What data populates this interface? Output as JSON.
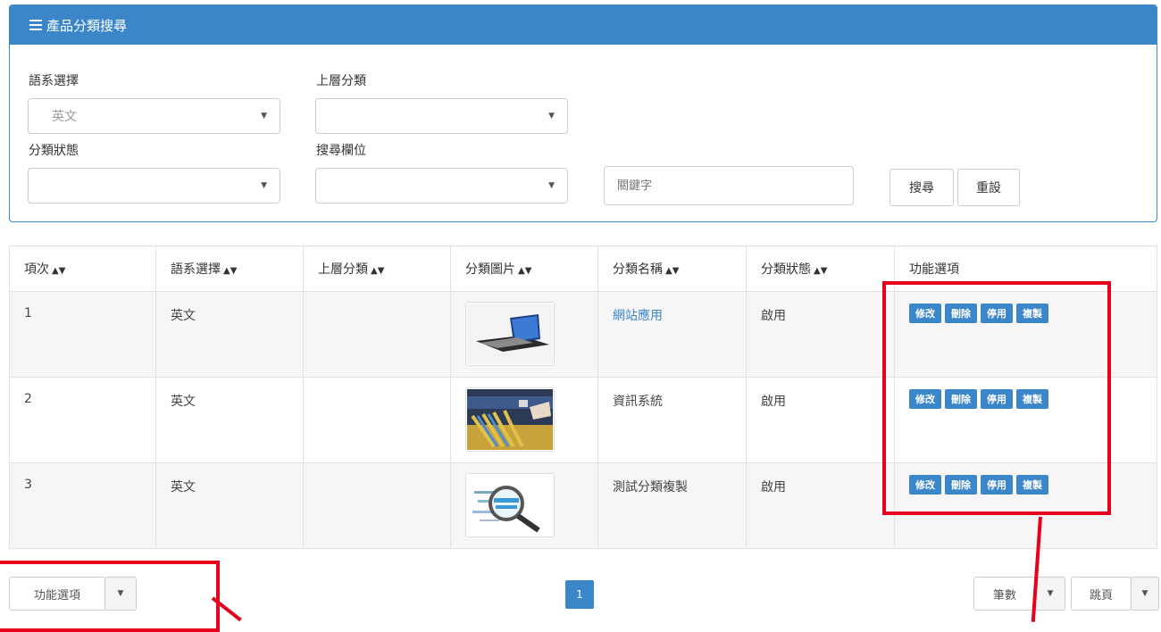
{
  "panel": {
    "title": "產品分類搜尋",
    "language_label": "語系選擇",
    "language_value": "英文",
    "parent_label": "上層分類",
    "parent_value": "",
    "status_label": "分類狀態",
    "status_value": "",
    "field_label": "搜尋欄位",
    "field_value": "",
    "keyword_placeholder": "關鍵字",
    "search_button": "搜尋",
    "reset_button": "重設"
  },
  "table": {
    "headers": [
      "項次",
      "語系選擇",
      "上層分類",
      "分類圖片",
      "分類名稱",
      "分類狀態",
      "功能選項"
    ],
    "rows": [
      {
        "index": "1",
        "language": "英文",
        "parent": "",
        "name": "網站應用",
        "status": "啟用"
      },
      {
        "index": "2",
        "language": "英文",
        "parent": "",
        "name": "資訊系統",
        "status": "啟用"
      },
      {
        "index": "3",
        "language": "英文",
        "parent": "",
        "name": "測試分類複製",
        "status": "啟用"
      }
    ],
    "actions": {
      "edit": "修改",
      "delete": "刪除",
      "disable": "停用",
      "copy": "複製"
    }
  },
  "footer": {
    "function_menu": "功能選項",
    "page": "1",
    "records": "筆數",
    "jump": "跳頁"
  },
  "colors": {
    "primary": "#3a86c8",
    "annotation": "#e6001b"
  }
}
